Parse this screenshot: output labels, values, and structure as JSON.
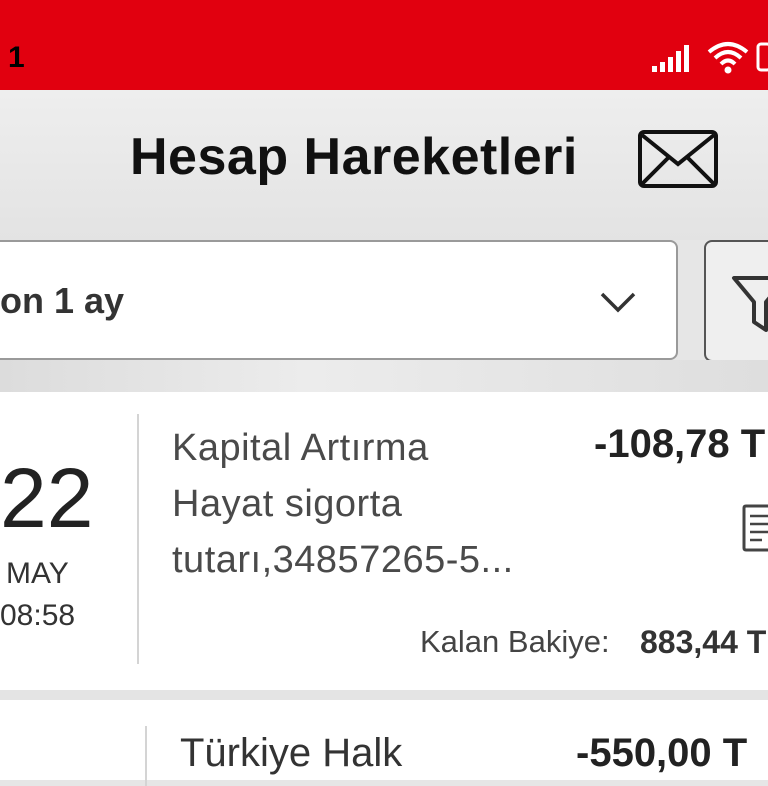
{
  "status_bar": {
    "time": "1",
    "icons": [
      "signal-icon",
      "wifi-icon",
      "battery-icon"
    ],
    "color": "#e1000f"
  },
  "header": {
    "title": "Hesap Hareketleri",
    "icon": "mail-icon"
  },
  "filter": {
    "period": "on 1 ay",
    "dropdown_icon": "chevron-down-icon",
    "filter_icon": "filter-icon"
  },
  "transactions": [
    {
      "day": "22",
      "month": "MAY",
      "time": "08:58",
      "description_lines": [
        "Kapital Artırma",
        "Hayat sigorta",
        "tutarı,34857265-5..."
      ],
      "amount": "-108,78 T",
      "balance_label": "Kalan Bakiye:",
      "balance": "883,44 T"
    },
    {
      "description_lines": [
        "Türkiye Halk"
      ],
      "amount": "-550,00 T"
    }
  ]
}
